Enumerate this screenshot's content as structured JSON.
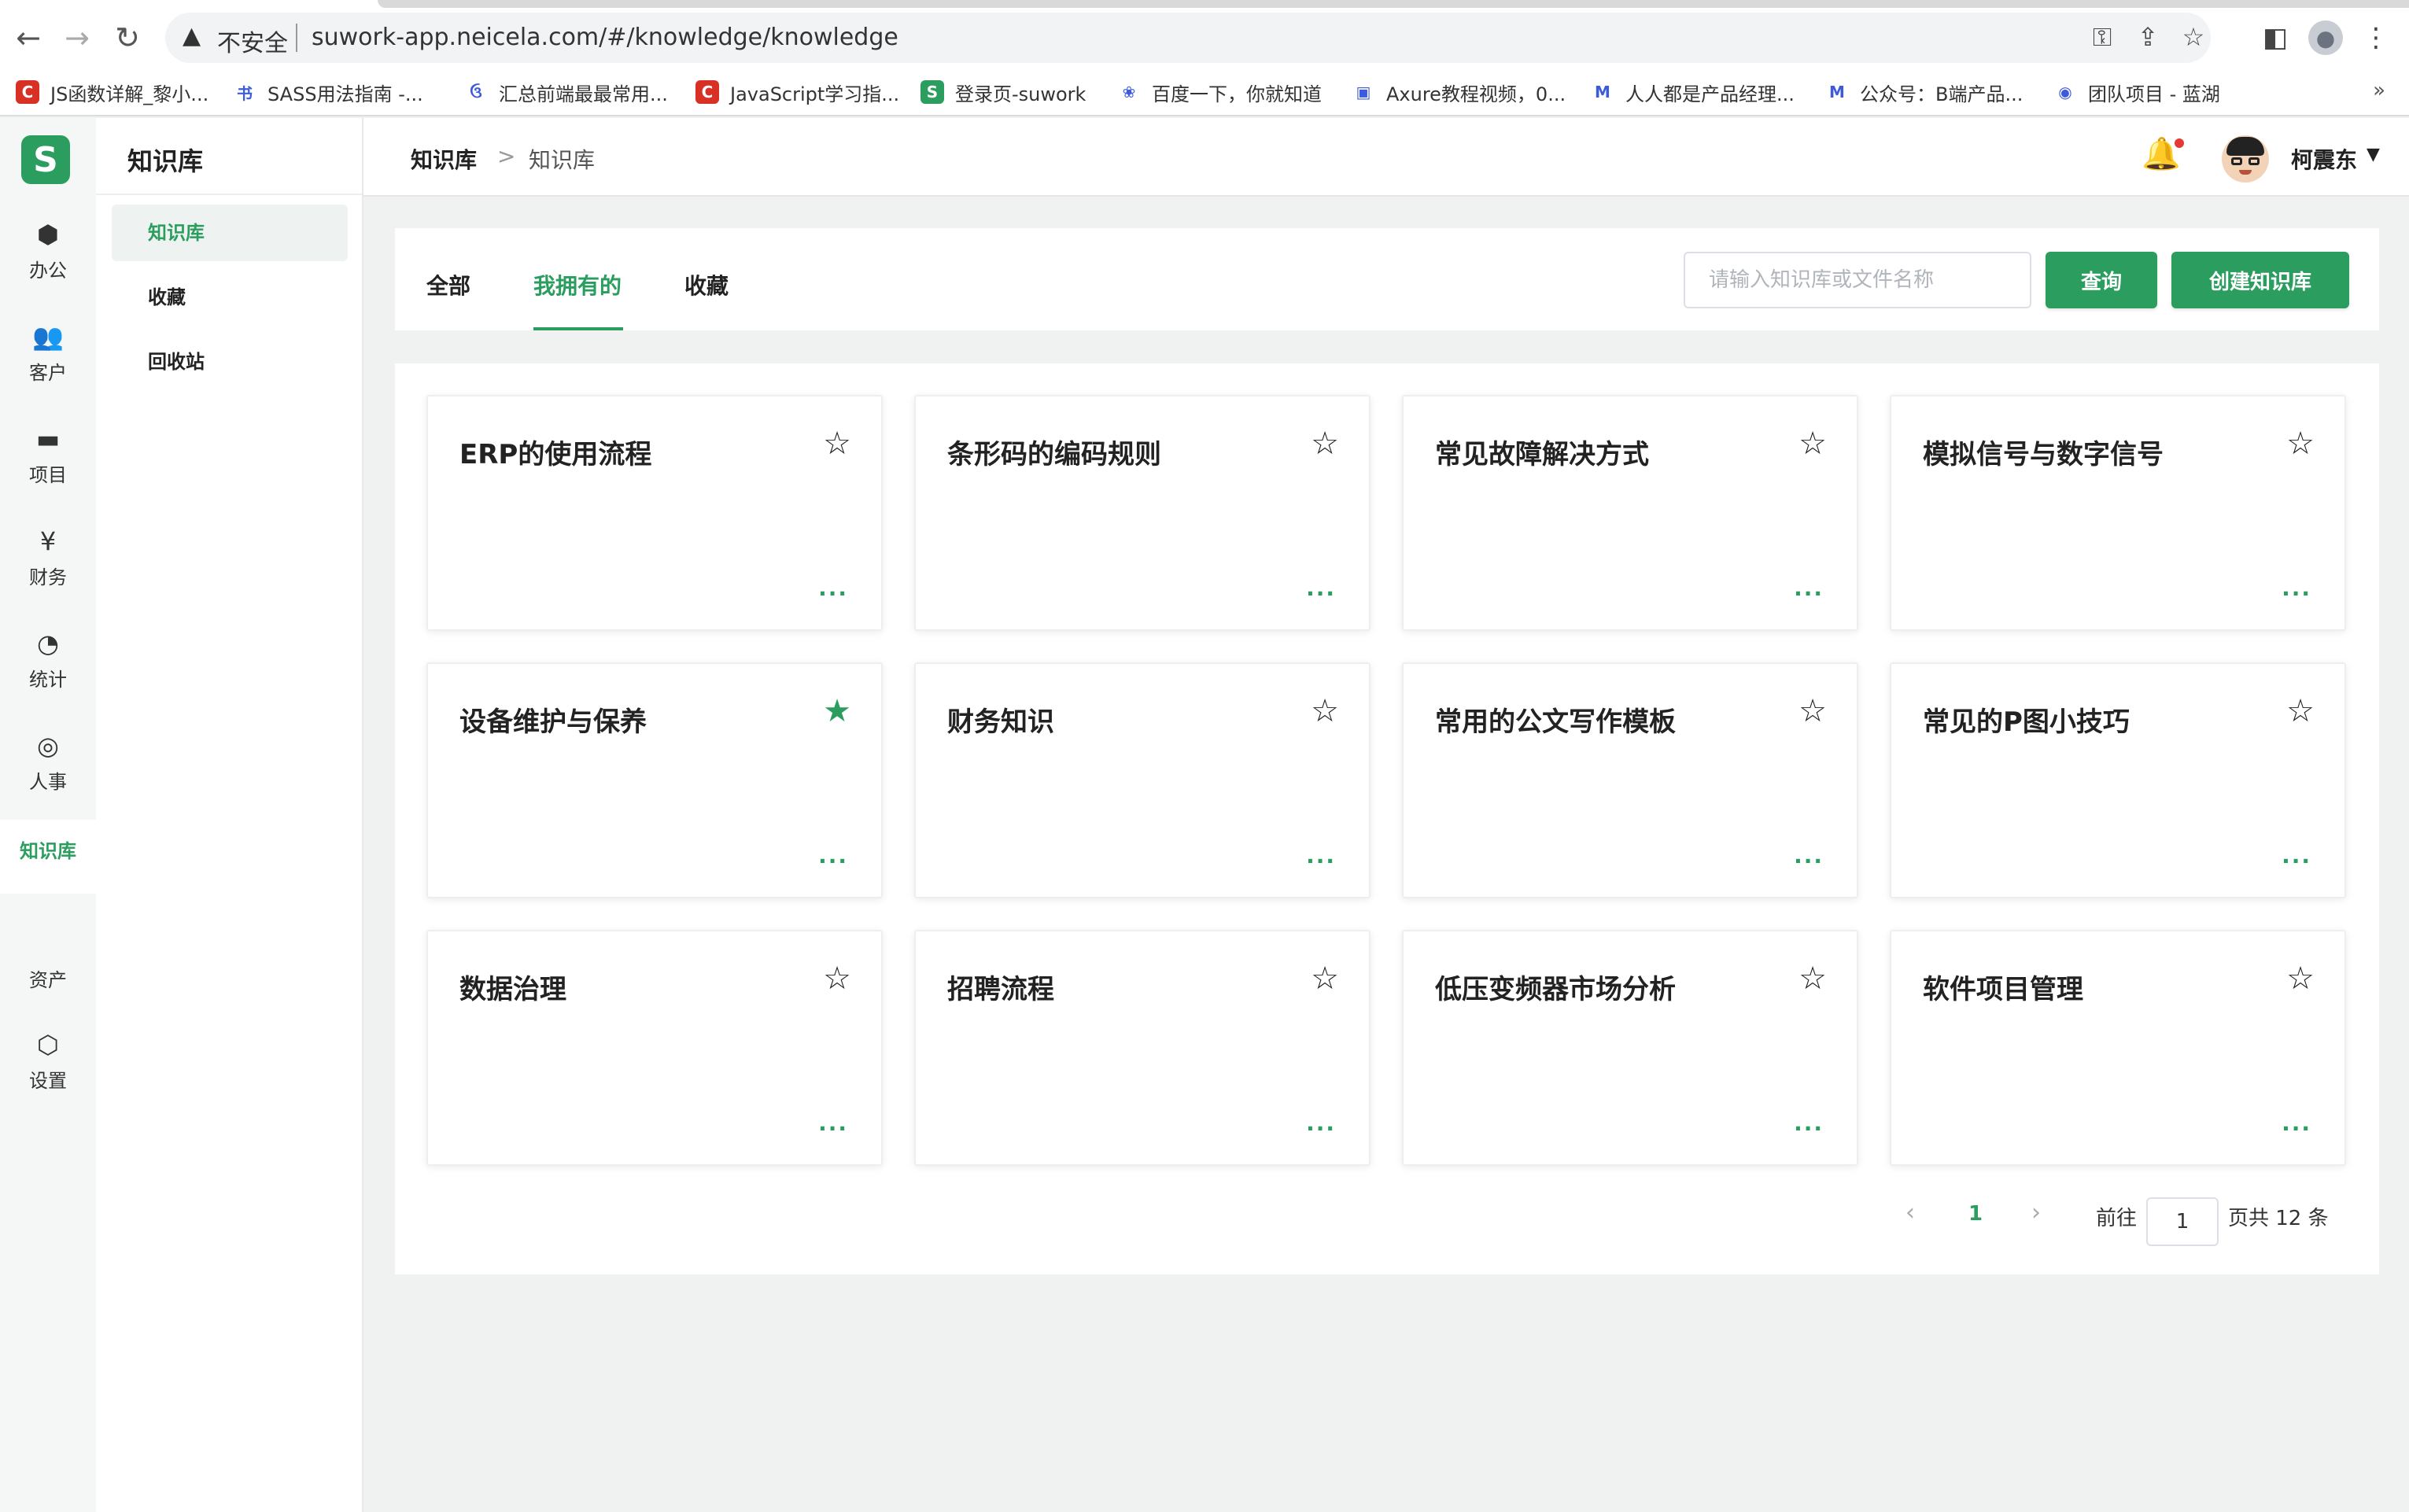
{
  "browser": {
    "insecure_label": "不安全",
    "url": "suwork-app.neicela.com/#/knowledge/knowledge",
    "bookmarks": [
      {
        "label": "JS函数详解_黎小...",
        "icon": "red-c-icon",
        "color": "#d93025",
        "glyph": "C"
      },
      {
        "label": "SASS用法指南 -...",
        "icon": "calligraphy-icon",
        "color": "#ffffff",
        "glyph": "书"
      },
      {
        "label": "汇总前端最最常用...",
        "icon": "swirl-icon",
        "color": "#ffffff",
        "glyph": "ઉ"
      },
      {
        "label": "JavaScript学习指...",
        "icon": "red-c-icon",
        "color": "#d93025",
        "glyph": "C"
      },
      {
        "label": "登录页-suwork",
        "icon": "suwork-s-icon",
        "color": "#2a9d5f",
        "glyph": "S"
      },
      {
        "label": "百度一下，你就知道",
        "icon": "baidu-paw-icon",
        "color": "#ffffff",
        "glyph": "❀"
      },
      {
        "label": "Axure教程视频，0...",
        "icon": "bilibili-tv-icon",
        "color": "#ffffff",
        "glyph": "▣"
      },
      {
        "label": "人人都是产品经理...",
        "icon": "pm-logo-icon",
        "color": "#ffffff",
        "glyph": "M"
      },
      {
        "label": "公众号：B端产品...",
        "icon": "pm-logo-icon",
        "color": "#ffffff",
        "glyph": "M"
      },
      {
        "label": "团队项目 - 蓝湖",
        "icon": "lanhu-icon",
        "color": "#ffffff",
        "glyph": "◉"
      }
    ],
    "more": "»"
  },
  "app": {
    "logo_letter": "S",
    "accent": "#2a9d5f",
    "rail": [
      {
        "label": "办公",
        "icon": "cube-icon",
        "glyph": "⬢"
      },
      {
        "label": "客户",
        "icon": "people-icon",
        "glyph": "👥"
      },
      {
        "label": "项目",
        "icon": "folder-icon",
        "glyph": "▬"
      },
      {
        "label": "财务",
        "icon": "finance-icon",
        "glyph": "¥"
      },
      {
        "label": "统计",
        "icon": "pie-chart-icon",
        "glyph": "◔"
      },
      {
        "label": "人事",
        "icon": "target-icon",
        "glyph": "◎"
      },
      {
        "label": "知识库",
        "icon": "",
        "glyph": ""
      },
      {
        "label": "资产",
        "icon": "",
        "glyph": ""
      },
      {
        "label": "设置",
        "icon": "settings-hex-icon",
        "glyph": "⬡"
      }
    ],
    "sidebar": {
      "title": "知识库",
      "items": [
        "知识库",
        "收藏",
        "回收站"
      ]
    },
    "header": {
      "breadcrumb": [
        "知识库",
        ">",
        "知识库"
      ],
      "user_name": "柯震东"
    },
    "tabs": [
      "全部",
      "我拥有的",
      "收藏"
    ],
    "search": {
      "placeholder": "请输入知识库或文件名称",
      "query_label": "查询",
      "create_label": "创建知识库"
    },
    "cards": [
      {
        "title": "ERP的使用流程",
        "starred": false
      },
      {
        "title": "条形码的编码规则",
        "starred": false
      },
      {
        "title": "常见故障解决方式",
        "starred": false
      },
      {
        "title": "模拟信号与数字信号",
        "starred": false
      },
      {
        "title": "设备维护与保养",
        "starred": true
      },
      {
        "title": "财务知识",
        "starred": false
      },
      {
        "title": "常用的公文写作模板",
        "starred": false
      },
      {
        "title": "常见的P图小技巧",
        "starred": false
      },
      {
        "title": "数据治理",
        "starred": false
      },
      {
        "title": "招聘流程",
        "starred": false
      },
      {
        "title": "低压变频器市场分析",
        "starred": false
      },
      {
        "title": "软件项目管理",
        "starred": false
      }
    ],
    "card_more": "...",
    "pagination": {
      "prev": "‹",
      "current": "1",
      "next": "›",
      "goto_label": "前往",
      "page_value": "1",
      "total_label": "页共 12 条"
    }
  }
}
